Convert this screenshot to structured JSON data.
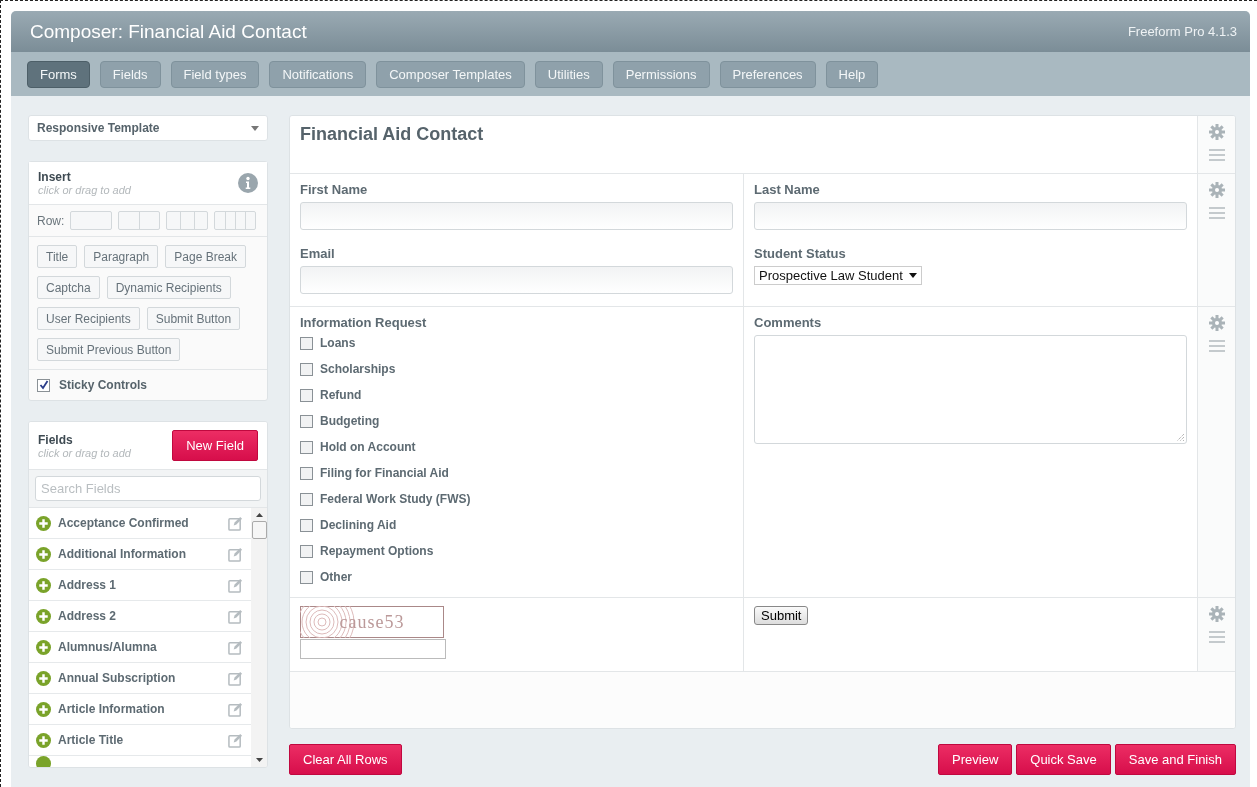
{
  "header": {
    "title": "Composer: Financial Aid Contact",
    "version": "Freeform Pro 4.1.3"
  },
  "nav": [
    {
      "label": "Forms",
      "selected": true
    },
    {
      "label": "Fields",
      "selected": false
    },
    {
      "label": "Field types",
      "selected": false
    },
    {
      "label": "Notifications",
      "selected": false
    },
    {
      "label": "Composer Templates",
      "selected": false
    },
    {
      "label": "Utilities",
      "selected": false
    },
    {
      "label": "Permissions",
      "selected": false
    },
    {
      "label": "Preferences",
      "selected": false
    },
    {
      "label": "Help",
      "selected": false
    }
  ],
  "template_select": {
    "value": "Responsive Template"
  },
  "insert": {
    "title": "Insert",
    "hint": "click or drag to add",
    "row_label": "Row:",
    "buttons": [
      "Title",
      "Paragraph",
      "Page Break",
      "Captcha",
      "Dynamic Recipients",
      "User Recipients",
      "Submit Button",
      "Submit Previous Button"
    ],
    "sticky": {
      "label": "Sticky Controls",
      "checked": true
    }
  },
  "fields_panel": {
    "title": "Fields",
    "hint": "click or drag to add",
    "new_button": "New Field",
    "search": {
      "placeholder": "Search Fields"
    },
    "items": [
      "Acceptance Confirmed",
      "Additional Information",
      "Address 1",
      "Address 2",
      "Alumnus/Alumna",
      "Annual Subscription",
      "Article Information",
      "Article Title"
    ]
  },
  "form": {
    "rows": [
      {
        "kind": "title",
        "text": "Financial Aid Contact"
      },
      {
        "kind": "fields",
        "columns": [
          [
            {
              "kind": "text",
              "label": "First Name"
            },
            {
              "kind": "text",
              "label": "Email"
            }
          ],
          [
            {
              "kind": "text",
              "label": "Last Name"
            },
            {
              "kind": "select",
              "label": "Student Status",
              "value": "Prospective Law Student"
            }
          ]
        ]
      },
      {
        "kind": "fields",
        "columns": [
          [
            {
              "kind": "checkboxes",
              "label": "Information Request",
              "options": [
                {
                  "label": "Loans",
                  "checked": false
                },
                {
                  "label": "Scholarships",
                  "checked": false
                },
                {
                  "label": "Refund",
                  "checked": false
                },
                {
                  "label": "Budgeting",
                  "checked": false
                },
                {
                  "label": "Hold on Account",
                  "checked": false
                },
                {
                  "label": "Filing for Financial Aid",
                  "checked": false
                },
                {
                  "label": "Federal Work Study (FWS)",
                  "checked": false
                },
                {
                  "label": "Declining Aid",
                  "checked": false
                },
                {
                  "label": "Repayment Options",
                  "checked": false
                },
                {
                  "label": "Other",
                  "checked": false
                }
              ]
            }
          ],
          [
            {
              "kind": "textarea",
              "label": "Comments"
            }
          ]
        ]
      },
      {
        "kind": "fields",
        "columns": [
          [
            {
              "kind": "captcha",
              "text": "cause53"
            }
          ],
          [
            {
              "kind": "submit",
              "label": "Submit"
            }
          ]
        ]
      }
    ]
  },
  "footer": {
    "left": [
      "Clear All Rows"
    ],
    "right": [
      "Preview",
      "Quick Save",
      "Save and Finish"
    ]
  }
}
